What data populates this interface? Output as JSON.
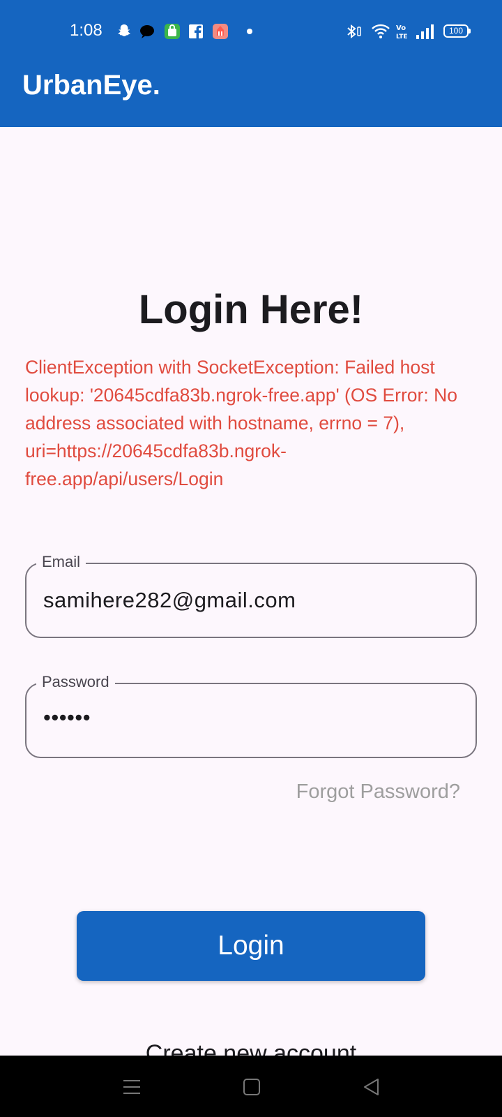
{
  "status_bar": {
    "time": "1:08",
    "notification_icons": [
      "snapchat-icon",
      "chat-bubble-icon",
      "shopping-bag-icon",
      "facebook-icon",
      "app-icon"
    ],
    "battery": "100"
  },
  "app_bar": {
    "title": "UrbanEye."
  },
  "main": {
    "heading": "Login Here!",
    "error_message": "ClientException with SocketException: Failed host lookup: '20645cdfa83b.ngrok-free.app' (OS Error: No address associated with hostname, errno = 7), uri=https://20645cdfa83b.ngrok-free.app/api/users/Login",
    "email": {
      "label": "Email",
      "value": "samihere282@gmail.com"
    },
    "password": {
      "label": "Password",
      "value": "••••••"
    },
    "forgot_password": "Forgot Password?",
    "login_button": "Login",
    "create_account": "Create new account"
  },
  "colors": {
    "primary": "#1565c0",
    "error": "#e04b3f",
    "background": "#fdf7fd"
  }
}
